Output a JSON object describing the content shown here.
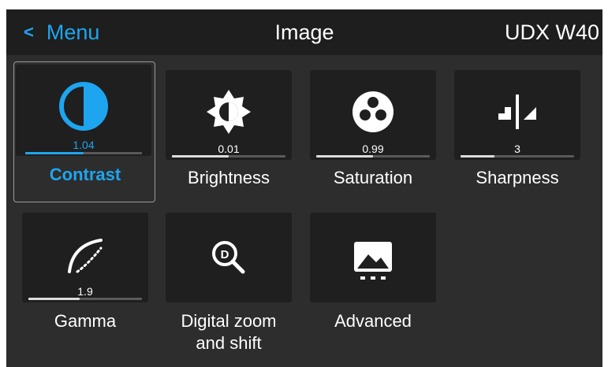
{
  "header": {
    "back_label": "Menu",
    "title": "Image",
    "model": "UDX W40"
  },
  "colors": {
    "accent": "#1ea5ef",
    "background": "#2d2d2d",
    "tile": "#1f1f1f",
    "header": "#1e1e1e"
  },
  "tiles": [
    {
      "label": "Contrast",
      "value": "1.04",
      "icon": "contrast-icon",
      "selected": true,
      "level": 0.5
    },
    {
      "label": "Brightness",
      "value": "0.01",
      "icon": "brightness-icon",
      "selected": false,
      "level": 0.5
    },
    {
      "label": "Saturation",
      "value": "0.99",
      "icon": "saturation-icon",
      "selected": false,
      "level": 0.5
    },
    {
      "label": "Sharpness",
      "value": "3",
      "icon": "sharpness-icon",
      "selected": false,
      "level": 0.3
    },
    {
      "label": "Gamma",
      "value": "1.9",
      "icon": "gamma-icon",
      "selected": false,
      "level": 0.45
    },
    {
      "label_lines": [
        "Digital zoom",
        "and shift"
      ],
      "icon": "digital-zoom-icon",
      "selected": false
    },
    {
      "label": "Advanced",
      "icon": "advanced-icon",
      "selected": false
    }
  ]
}
